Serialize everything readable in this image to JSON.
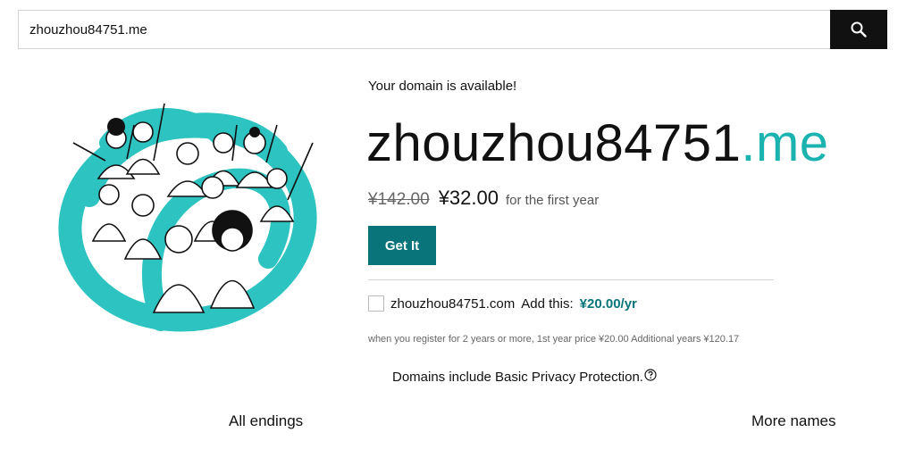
{
  "search": {
    "value": "zhouzhou84751.me",
    "button_icon": "search-icon"
  },
  "hero": {
    "icon": "crowd-illustration"
  },
  "result": {
    "status": "Your domain is available!",
    "domain_base": "zhouzhou84751",
    "domain_tld": ".me",
    "old_price": "¥142.00",
    "new_price": "¥32.00",
    "price_note": "for the first year",
    "cta_label": "Get It"
  },
  "addon": {
    "domain": "zhouzhou84751.com",
    "label": "Add this:",
    "price": "¥20.00/yr",
    "fine_print": "when you register for 2 years or more, 1st year price ¥20.00 Additional years ¥120.17"
  },
  "privacy": {
    "text": "Domains include Basic Privacy Protection.",
    "icon": "help-circle-icon"
  },
  "tabs": {
    "all_endings": "All endings",
    "more_names": "More names"
  },
  "colors": {
    "accent_teal": "#1ab3b0",
    "button_teal": "#09757a",
    "search_button": "#111111"
  }
}
